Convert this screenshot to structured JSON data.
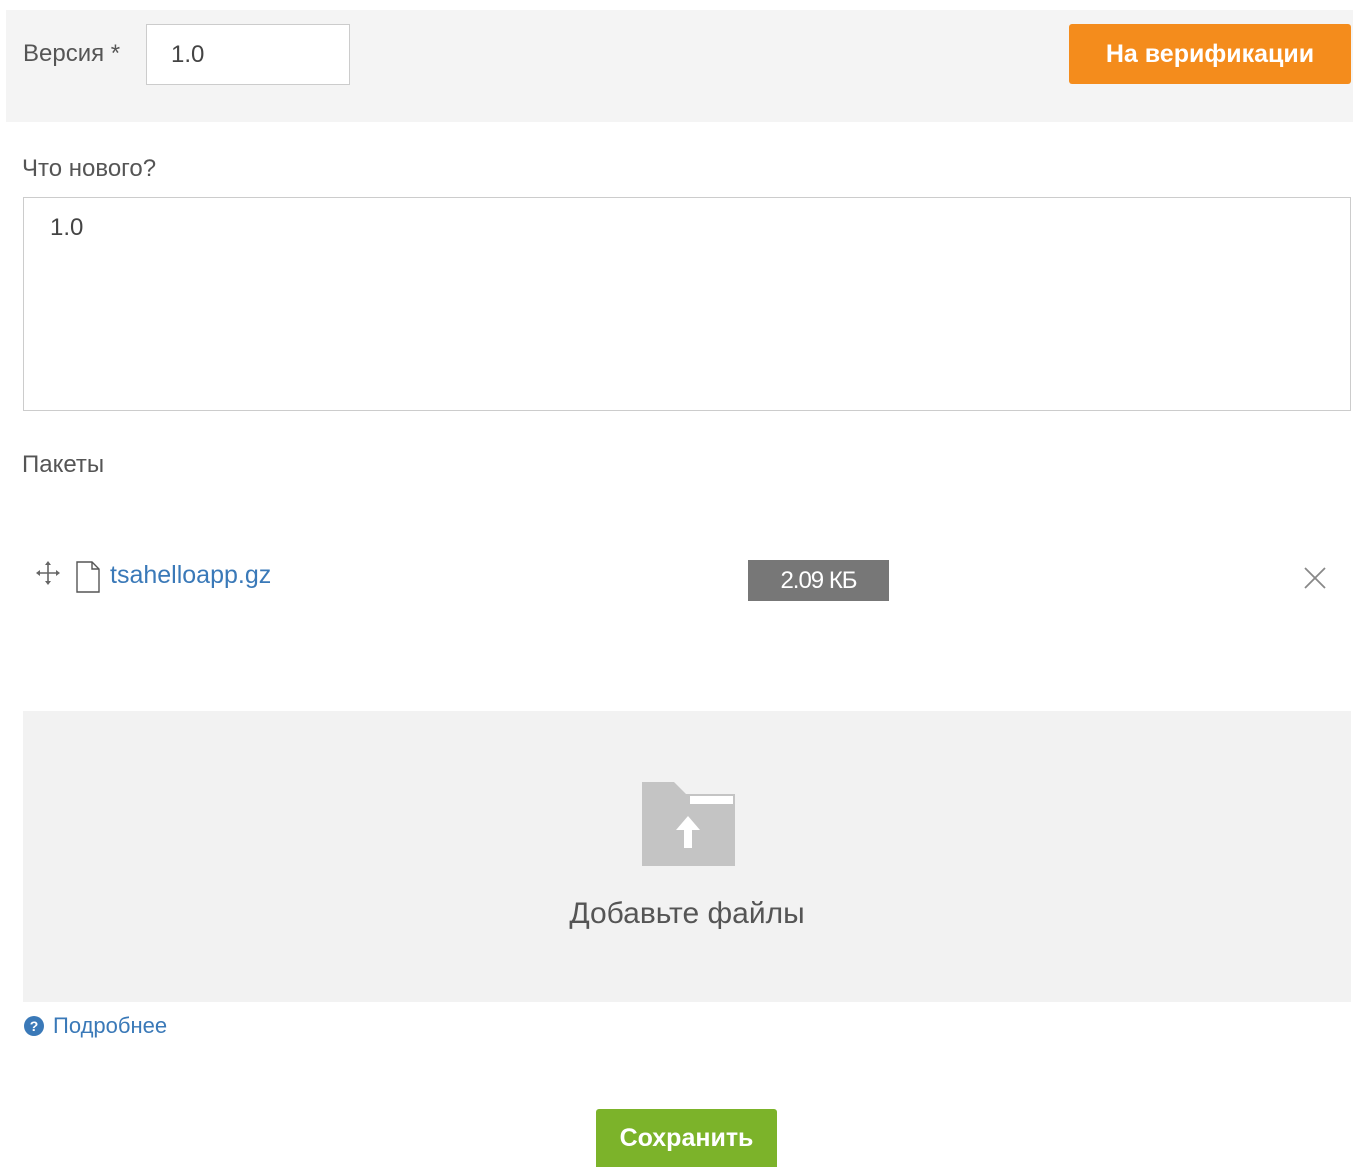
{
  "header": {
    "version_label": "Версия *",
    "version_value": "1.0",
    "status_button_label": "На верификации",
    "status_color": "#f48c1c"
  },
  "whats_new": {
    "label": "Что нового?",
    "value": "1.0"
  },
  "packages": {
    "label": "Пакеты",
    "items": [
      {
        "file_name": "tsahelloapp.gz",
        "size": "2.09 КБ",
        "icons": [
          "move-icon",
          "file-icon",
          "close-icon"
        ]
      }
    ]
  },
  "dropzone": {
    "text": "Добавьте файлы",
    "icon": "folder-upload-icon"
  },
  "help": {
    "link_label": "Подробнее",
    "icon": "question-circle-icon"
  },
  "actions": {
    "save_label": "Сохранить",
    "save_color": "#7cb32a"
  }
}
